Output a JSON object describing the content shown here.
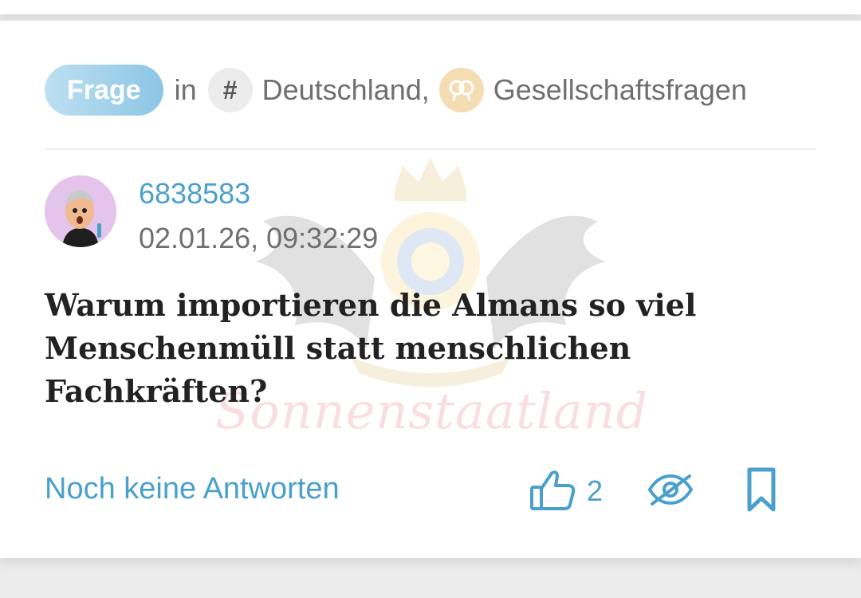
{
  "question": {
    "type_badge": "Frage",
    "in_label": "in",
    "topics": [
      {
        "icon": "hash-icon",
        "label": "Deutschland,"
      },
      {
        "icon": "society-icon",
        "label": "Gesellschaftsfragen"
      }
    ],
    "author": "6838583",
    "timestamp": "02.01.26, 09:32:29",
    "title": "Warum importieren die Almans so viel Menschenmüll statt menschlichen Fachkräften?",
    "watermark_text": "Sonnenstaatland"
  },
  "footer": {
    "answers_label": "Noch keine Antworten",
    "like_count": "2",
    "icons": [
      "thumbs-up-icon",
      "eye-slash-icon",
      "bookmark-icon"
    ]
  },
  "colors": {
    "accent_blue": "#4aa0cd",
    "badge_gradient_start": "#bde0f1",
    "badge_gradient_end": "#8cc6e5",
    "meta_gray": "#6f6f6f",
    "title_dark": "#222222",
    "hash_bg": "#ececec",
    "society_bg": "#f4dcb3",
    "avatar_bg": "#e4c4ea"
  }
}
